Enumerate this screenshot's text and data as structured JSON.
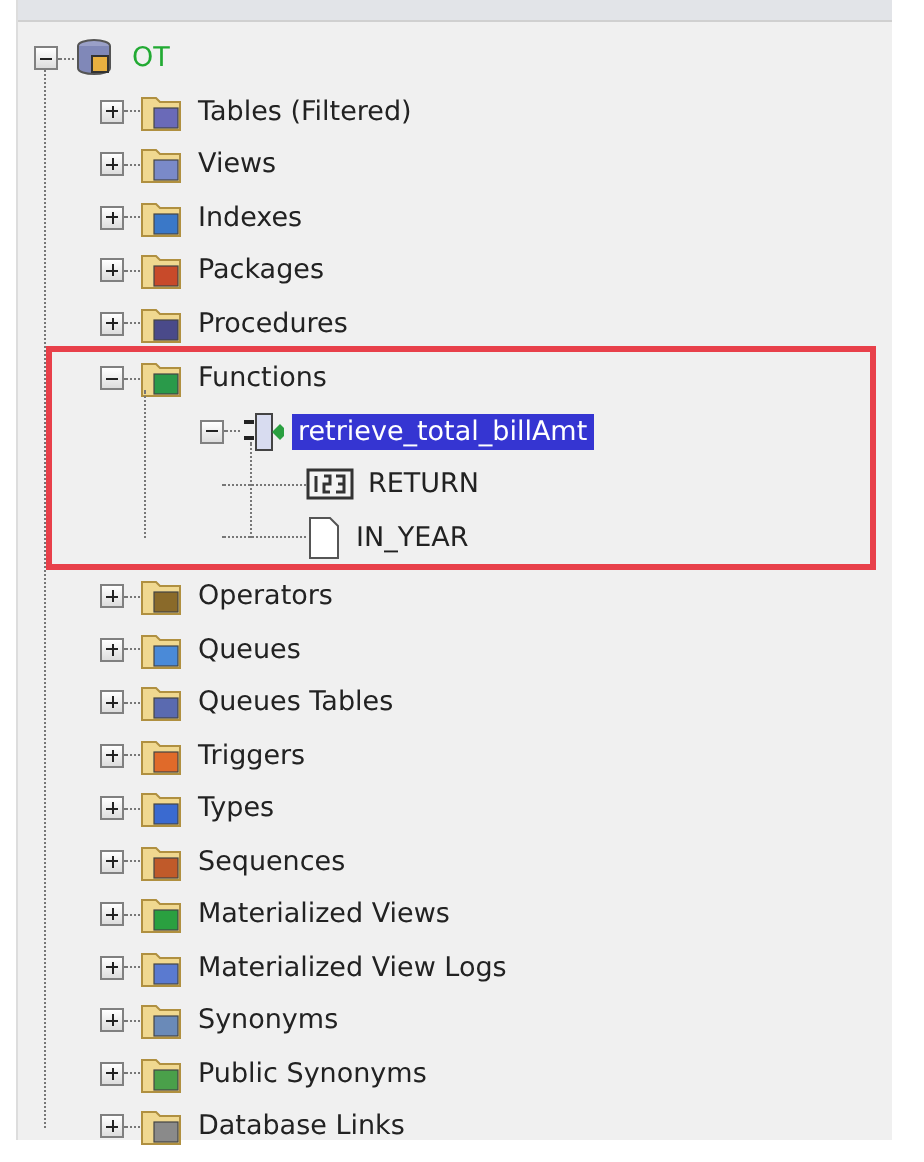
{
  "tree": [
    {
      "label": "OT",
      "kind": "schema",
      "expanded": true,
      "selected": false,
      "children": [
        {
          "label": "Tables (Filtered)",
          "kind": "folder",
          "expanded": false,
          "selected": false
        },
        {
          "label": "Views",
          "kind": "folder",
          "expanded": false,
          "selected": false
        },
        {
          "label": "Indexes",
          "kind": "folder",
          "expanded": false,
          "selected": false
        },
        {
          "label": "Packages",
          "kind": "folder",
          "expanded": false,
          "selected": false
        },
        {
          "label": "Procedures",
          "kind": "folder",
          "expanded": false,
          "selected": false
        },
        {
          "label": "Functions",
          "kind": "folder",
          "expanded": true,
          "selected": false,
          "highlighted": true,
          "children": [
            {
              "label": "retrieve_total_billAmt",
              "kind": "function",
              "expanded": true,
              "selected": true,
              "children": [
                {
                  "label": "RETURN",
                  "kind": "return",
                  "selected": false
                },
                {
                  "label": "IN_YEAR",
                  "kind": "parameter",
                  "selected": false
                }
              ]
            }
          ]
        },
        {
          "label": "Operators",
          "kind": "folder",
          "expanded": false,
          "selected": false
        },
        {
          "label": "Queues",
          "kind": "folder",
          "expanded": false,
          "selected": false
        },
        {
          "label": "Queues Tables",
          "kind": "folder",
          "expanded": false,
          "selected": false
        },
        {
          "label": "Triggers",
          "kind": "folder",
          "expanded": false,
          "selected": false
        },
        {
          "label": "Types",
          "kind": "folder",
          "expanded": false,
          "selected": false
        },
        {
          "label": "Sequences",
          "kind": "folder",
          "expanded": false,
          "selected": false
        },
        {
          "label": "Materialized Views",
          "kind": "folder",
          "expanded": false,
          "selected": false
        },
        {
          "label": "Materialized View Logs",
          "kind": "folder",
          "expanded": false,
          "selected": false
        },
        {
          "label": "Synonyms",
          "kind": "folder",
          "expanded": false,
          "selected": false
        },
        {
          "label": "Public Synonyms",
          "kind": "folder",
          "expanded": false,
          "selected": false
        },
        {
          "label": "Database Links",
          "kind": "folder",
          "expanded": false,
          "selected": false
        }
      ]
    }
  ]
}
